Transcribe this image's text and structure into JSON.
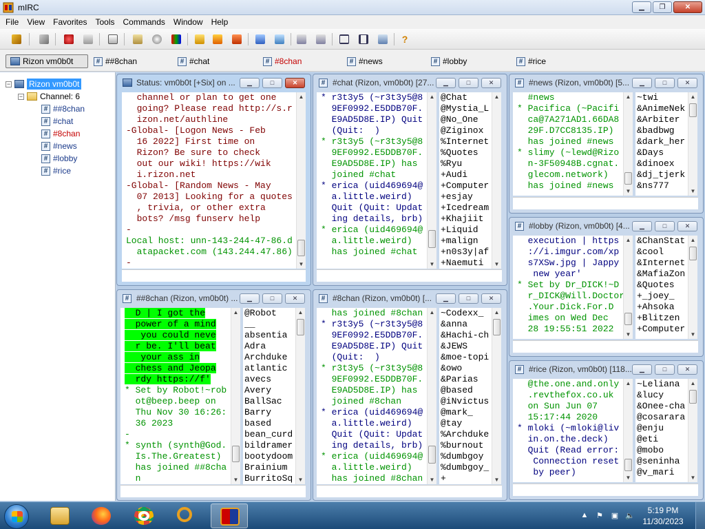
{
  "app": {
    "title": "mIRC"
  },
  "menu": [
    "File",
    "View",
    "Favorites",
    "Tools",
    "Commands",
    "Window",
    "Help"
  ],
  "switchbar": [
    {
      "label": "Rizon vm0b0t",
      "kind": "server",
      "active": true
    },
    {
      "label": "##8chan",
      "kind": "channel"
    },
    {
      "label": "#chat",
      "kind": "channel"
    },
    {
      "label": "#8chan",
      "kind": "channel",
      "highlight": true
    },
    {
      "label": "#news",
      "kind": "channel"
    },
    {
      "label": "#lobby",
      "kind": "channel"
    },
    {
      "label": "#rice",
      "kind": "channel"
    }
  ],
  "tree": {
    "server": "Rizon vm0b0t",
    "group": "Channel: 6",
    "channels": [
      "##8chan",
      "#chat",
      "#8chan",
      "#news",
      "#lobby",
      "#rice"
    ]
  },
  "windows": {
    "status": {
      "title": "Status: vm0b0t [+Six] on ...",
      "lines": [
        {
          "t": "  channel or plan to get one",
          "c": "c-brown"
        },
        {
          "t": "  going? Please read http://s.r",
          "c": "c-brown"
        },
        {
          "t": "  izon.net/authline",
          "c": "c-brown"
        },
        {
          "t": "-Global- [Logon News - Feb",
          "c": "c-brown"
        },
        {
          "t": "  16 2022] First time on",
          "c": "c-brown"
        },
        {
          "t": "  Rizon? Be sure to check",
          "c": "c-brown"
        },
        {
          "t": "  out our wiki! https://wik",
          "c": "c-brown"
        },
        {
          "t": "  i.rizon.net",
          "c": "c-brown"
        },
        {
          "t": "-Global- [Random News - May",
          "c": "c-brown"
        },
        {
          "t": "  07 2013] Looking for a quotes",
          "c": "c-brown"
        },
        {
          "t": "  , trivia, or other extra",
          "c": "c-brown"
        },
        {
          "t": "  bots? /msg funserv help",
          "c": "c-brown"
        },
        {
          "t": "-",
          "c": "c-brown"
        },
        {
          "t": "Local host: unn-143-244-47-86.d",
          "c": "c-join"
        },
        {
          "t": "  atapacket.com (143.244.47.86)",
          "c": "c-join"
        },
        {
          "t": "-",
          "c": "c-brown"
        }
      ]
    },
    "chat": {
      "title": "#chat (Rizon, vm0b0t) [27...",
      "lines": [
        {
          "t": "* r3t3y5 (~r3t3y5@8",
          "c": "c-quit"
        },
        {
          "t": "  9EF0992.E5DDB70F.",
          "c": "c-quit"
        },
        {
          "t": "  E9AD5D8E.IP) Quit",
          "c": "c-quit"
        },
        {
          "t": "  (Quit:  )",
          "c": "c-quit"
        },
        {
          "t": "* r3t3y5 (~r3t3y5@8",
          "c": "c-join"
        },
        {
          "t": "  9EF0992.E5DDB70F.",
          "c": "c-join"
        },
        {
          "t": "  E9AD5D8E.IP) has",
          "c": "c-join"
        },
        {
          "t": "  joined #chat",
          "c": "c-join"
        },
        {
          "t": "* erica (uid469694@",
          "c": "c-quit"
        },
        {
          "t": "  a.little.weird)",
          "c": "c-quit"
        },
        {
          "t": "  Quit (Quit: Updat",
          "c": "c-quit"
        },
        {
          "t": "  ing details, brb)",
          "c": "c-quit"
        },
        {
          "t": "* erica (uid469694@",
          "c": "c-join"
        },
        {
          "t": "  a.little.weird)",
          "c": "c-join"
        },
        {
          "t": "  has joined #chat",
          "c": "c-join"
        }
      ],
      "nicks": [
        "@Chat",
        "@Mystia_L",
        "@No_One",
        "@Ziginox",
        "%Internet",
        "%Quotes",
        "%Ryu",
        "+Audi",
        "+Computer",
        "+esjay",
        "+Icedream",
        "+Khajiit",
        "+Liquid",
        "+malign",
        "+n0s3y|af",
        "+Naemuti"
      ]
    },
    "news": {
      "title": "#news (Rizon, vm0b0t) [5...",
      "lines": [
        {
          "t": "  #news",
          "c": "c-join"
        },
        {
          "t": "* Pacifica (~Pacifi",
          "c": "c-join"
        },
        {
          "t": "  ca@7A271AD1.66DA8",
          "c": "c-join"
        },
        {
          "t": "  29F.D7CC8135.IP)",
          "c": "c-join"
        },
        {
          "t": "  has joined #news",
          "c": "c-join"
        },
        {
          "t": "* slimy (~lewd@Rizo",
          "c": "c-join"
        },
        {
          "t": "  n-3F50948B.cgnat.",
          "c": "c-join"
        },
        {
          "t": "  glecom.network)",
          "c": "c-join"
        },
        {
          "t": "  has joined #news",
          "c": "c-join"
        }
      ],
      "nicks": [
        "~twi",
        "&AnimeNek",
        "&Arbiter",
        "&badbwg",
        "&dark_her",
        "&Days",
        "&dinoex",
        "&dj_tjerk",
        "&ns777"
      ]
    },
    "lobby": {
      "title": "#lobby (Rizon, vm0b0t) [4...",
      "lines": [
        {
          "t": "  execution | https",
          "c": "c-quit"
        },
        {
          "t": "  ://i.imgur.com/xp",
          "c": "c-quit"
        },
        {
          "t": "  s7XSw.jpg | Jappy",
          "c": "c-quit"
        },
        {
          "t": "   new year'",
          "c": "c-quit"
        },
        {
          "t": "* Set by Dr_DICK!~D",
          "c": "c-join"
        },
        {
          "t": "  r_DICK@Will.Doctor",
          "c": "c-join"
        },
        {
          "t": "  .Your.Dick.For.D",
          "c": "c-join"
        },
        {
          "t": "  imes on Wed Dec",
          "c": "c-join"
        },
        {
          "t": "  28 19:55:51 2022",
          "c": "c-join"
        }
      ],
      "nicks": [
        "&ChanStat",
        "&cool",
        "&Internet",
        "&MafiaZon",
        "&Quotes",
        "+_joey_",
        "+Ahsoka",
        "+Blitzen",
        "+Computer"
      ]
    },
    "rice": {
      "title": "#rice (Rizon, vm0b0t) [118...",
      "lines": [
        {
          "t": "  @the.one.and.only",
          "c": "c-join"
        },
        {
          "t": "  .revthefox.co.uk",
          "c": "c-join"
        },
        {
          "t": "  on Sun Jun 07",
          "c": "c-join"
        },
        {
          "t": "  15:17:44 2020",
          "c": "c-join"
        },
        {
          "t": "* mloki (~mloki@liv",
          "c": "c-quit"
        },
        {
          "t": "  in.on.the.deck)",
          "c": "c-quit"
        },
        {
          "t": "  Quit (Read error:",
          "c": "c-quit"
        },
        {
          "t": "   Connection reset",
          "c": "c-quit"
        },
        {
          "t": "   by peer)",
          "c": "c-quit"
        }
      ],
      "nicks": [
        "~Leliana",
        "&lucy",
        "&Onee-cha",
        "@cosarara",
        "@enju",
        "@eti",
        "@mobo",
        "@seninha",
        "@v_mari"
      ]
    },
    "chan88": {
      "title": "##8chan (Rizon, vm0b0t) ...",
      "lines": [
        {
          "t": "  D | I got the",
          "c": "c-hl"
        },
        {
          "t": "  power of a mind",
          "c": "c-hl"
        },
        {
          "t": "   you could neve",
          "c": "c-hl"
        },
        {
          "t": "  r be. I'll beat",
          "c": "c-hl"
        },
        {
          "t": "   your ass in",
          "c": "c-hl"
        },
        {
          "t": "  chess and Jeopa",
          "c": "c-hl"
        },
        {
          "t": "  rdy https://f'",
          "c": "c-hl"
        },
        {
          "t": "* Set by Robot!~rob",
          "c": "c-join"
        },
        {
          "t": "  ot@beep.beep on",
          "c": "c-join"
        },
        {
          "t": "  Thu Nov 30 16:26:",
          "c": "c-join"
        },
        {
          "t": "  36 2023",
          "c": "c-join"
        },
        {
          "t": "-",
          "c": "c-join"
        },
        {
          "t": "* synth (synth@God.",
          "c": "c-join"
        },
        {
          "t": "  Is.The.Greatest)",
          "c": "c-join"
        },
        {
          "t": "  has joined ##8cha",
          "c": "c-join"
        },
        {
          "t": "  n",
          "c": "c-join"
        }
      ],
      "nicks": [
        "@Robot",
        "__",
        "absentia",
        "Adra",
        "Archduke",
        "atlantic",
        "avecs",
        "Avery",
        "BallSac",
        "Barry",
        "based",
        "bean_curd",
        "bildramer",
        "bootydoom",
        "Brainium",
        "BurritoSq"
      ]
    },
    "chan8": {
      "title": "#8chan (Rizon, vm0b0t) [...",
      "lines": [
        {
          "t": "  has joined #8chan",
          "c": "c-join"
        },
        {
          "t": "* r3t3y5 (~r3t3y5@8",
          "c": "c-quit"
        },
        {
          "t": "  9EF0992.E5DDB70F.",
          "c": "c-quit"
        },
        {
          "t": "  E9AD5D8E.IP) Quit",
          "c": "c-quit"
        },
        {
          "t": "  (Quit:  )",
          "c": "c-quit"
        },
        {
          "t": "* r3t3y5 (~r3t3y5@8",
          "c": "c-join"
        },
        {
          "t": "  9EF0992.E5DDB70F.",
          "c": "c-join"
        },
        {
          "t": "  E9AD5D8E.IP) has",
          "c": "c-join"
        },
        {
          "t": "  joined #8chan",
          "c": "c-join"
        },
        {
          "t": "* erica (uid469694@",
          "c": "c-quit"
        },
        {
          "t": "  a.little.weird)",
          "c": "c-quit"
        },
        {
          "t": "  Quit (Quit: Updat",
          "c": "c-quit"
        },
        {
          "t": "  ing details, brb)",
          "c": "c-quit"
        },
        {
          "t": "* erica (uid469694@",
          "c": "c-join"
        },
        {
          "t": "  a.little.weird)",
          "c": "c-join"
        },
        {
          "t": "  has joined #8chan",
          "c": "c-join"
        }
      ],
      "nicks": [
        "~Codexx_",
        "&anna",
        "&Hachi-ch",
        "&JEWS",
        "&moe-topi",
        "&owo",
        "&Parias",
        "@based",
        "@iNvictus",
        "@mark_",
        "@tay",
        "%Archduke",
        "%burnout",
        "%dumbgoy",
        "%dumbgoy_",
        "+"
      ]
    }
  },
  "tray": {
    "time": "5:19 PM",
    "date": "11/30/2023"
  },
  "colors": {
    "join": "#009300",
    "quit": "#00007f",
    "notice": "#7f0000",
    "highlight": "#00ff00",
    "selection": "#3399ff"
  }
}
